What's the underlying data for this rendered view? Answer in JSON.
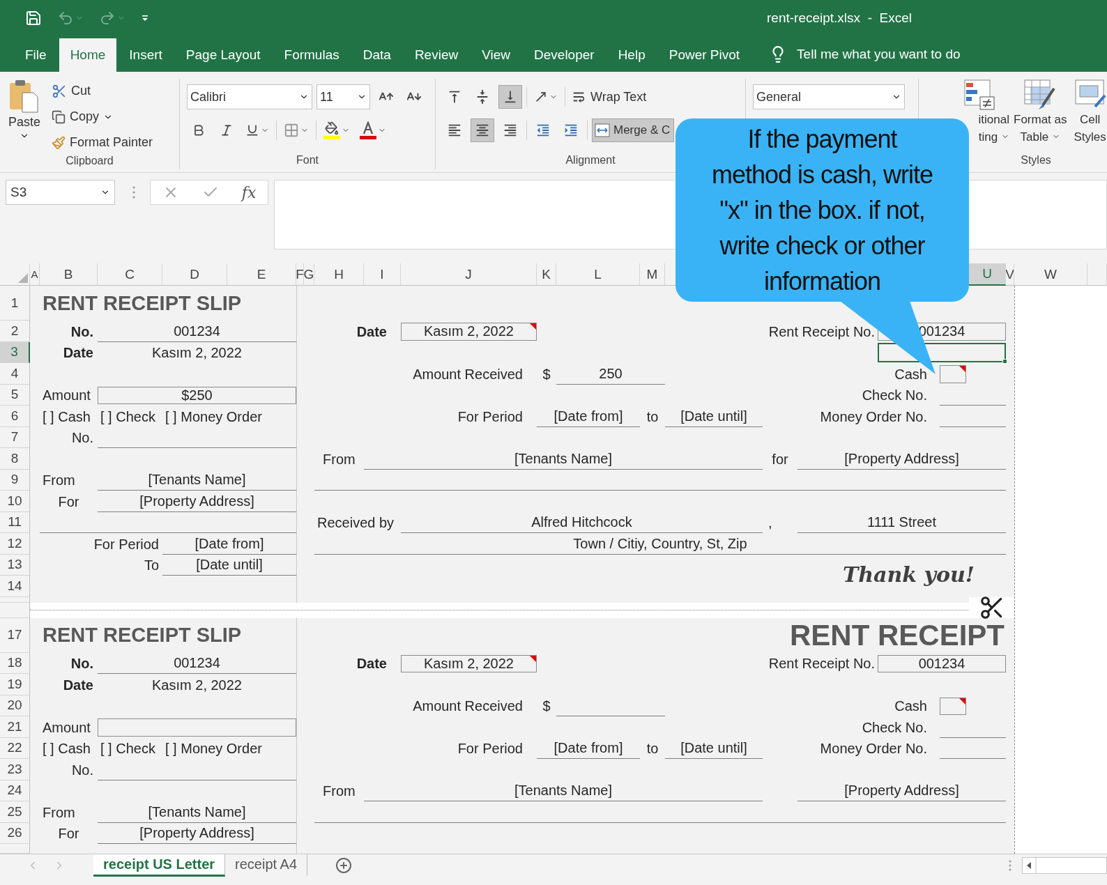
{
  "window": {
    "title": "rent-receipt.xlsx  -  Excel"
  },
  "quick_access": [
    {
      "kind": "save",
      "disabled": false
    },
    {
      "kind": "undo",
      "disabled": true
    },
    {
      "kind": "redo",
      "disabled": true
    },
    {
      "kind": "customize",
      "disabled": false
    }
  ],
  "ribbon_tabs": [
    {
      "label": "File",
      "selected": false
    },
    {
      "label": "Home",
      "selected": true
    },
    {
      "label": "Insert",
      "selected": false
    },
    {
      "label": "Page Layout",
      "selected": false
    },
    {
      "label": "Formulas",
      "selected": false
    },
    {
      "label": "Data",
      "selected": false
    },
    {
      "label": "Review",
      "selected": false
    },
    {
      "label": "View",
      "selected": false
    },
    {
      "label": "Developer",
      "selected": false
    },
    {
      "label": "Help",
      "selected": false
    },
    {
      "label": "Power Pivot",
      "selected": false
    }
  ],
  "tell_me": "Tell me what you want to do",
  "clipboard": {
    "label": "Clipboard",
    "paste": "Paste",
    "cut": "Cut",
    "copy": "Copy",
    "format_painter": "Format Painter"
  },
  "font": {
    "label": "Font",
    "font_name": "Calibri",
    "font_size": "11"
  },
  "alignment": {
    "label": "Alignment",
    "wrap_text": "Wrap Text",
    "merge": {
      "label": "Merge & C",
      "selected": true
    },
    "vertical_align": [
      {
        "kind": "top",
        "selected": false
      },
      {
        "kind": "middle",
        "selected": false
      },
      {
        "kind": "bottom",
        "selected": true
      }
    ],
    "horizontal_align": [
      {
        "kind": "left",
        "selected": false
      },
      {
        "kind": "center",
        "selected": true
      },
      {
        "kind": "right",
        "selected": false
      }
    ]
  },
  "number": {
    "format": "General"
  },
  "styles": {
    "label": "Styles",
    "conditional_formatting": [
      "itional",
      "ting"
    ],
    "format_as_table": [
      "Format as",
      "Table"
    ],
    "cell_styles": [
      "Cell",
      "Styles"
    ]
  },
  "formula_bar": {
    "name_box": "S3",
    "function_label": "fx"
  },
  "sheet": {
    "columns": [
      {
        "label": "A",
        "selected": false
      },
      {
        "label": "B",
        "selected": false
      },
      {
        "label": "C",
        "selected": false
      },
      {
        "label": "D",
        "selected": false
      },
      {
        "label": "E",
        "selected": false
      },
      {
        "label": "F",
        "selected": false
      },
      {
        "label": "G",
        "selected": false
      },
      {
        "label": "H",
        "selected": false
      },
      {
        "label": "I",
        "selected": false
      },
      {
        "label": "J",
        "selected": false
      },
      {
        "label": "K",
        "selected": false
      },
      {
        "label": "L",
        "selected": false
      },
      {
        "label": "M",
        "selected": false
      },
      {
        "label": "U",
        "selected": true
      },
      {
        "label": "V",
        "selected": false
      },
      {
        "label": "W",
        "selected": false
      }
    ],
    "rows": [
      {
        "label": "1",
        "selected": false
      },
      {
        "label": "2",
        "selected": false
      },
      {
        "label": "3",
        "selected": true
      },
      {
        "label": "4",
        "selected": false
      },
      {
        "label": "5",
        "selected": false
      },
      {
        "label": "6",
        "selected": false
      },
      {
        "label": "7",
        "selected": false
      },
      {
        "label": "8",
        "selected": false
      },
      {
        "label": "9",
        "selected": false
      },
      {
        "label": "10",
        "selected": false
      },
      {
        "label": "11",
        "selected": false
      },
      {
        "label": "12",
        "selected": false
      },
      {
        "label": "13",
        "selected": false
      },
      {
        "label": "14",
        "selected": false
      },
      {
        "label": "17",
        "selected": false
      },
      {
        "label": "18",
        "selected": false
      },
      {
        "label": "19",
        "selected": false
      },
      {
        "label": "20",
        "selected": false
      },
      {
        "label": "21",
        "selected": false
      },
      {
        "label": "22",
        "selected": false
      },
      {
        "label": "23",
        "selected": false
      },
      {
        "label": "24",
        "selected": false
      },
      {
        "label": "25",
        "selected": false
      },
      {
        "label": "26",
        "selected": false
      }
    ]
  },
  "copies": [
    {
      "slip": {
        "title": "RENT RECEIPT SLIP",
        "no_label": "No.",
        "no": "001234",
        "date_label": "Date",
        "date": "Kasım 2, 2022",
        "amount_label": "Amount",
        "amount": "$250",
        "payment_options": [
          "[ ] Cash",
          "[ ] Check",
          "[ ] Money Order"
        ],
        "number_label": "No.",
        "from_label": "From",
        "tenant": "[Tenants Name]",
        "for_label": "For",
        "property": "[Property Address]",
        "period_label": "For Period",
        "period_from": "[Date from]",
        "to_label": "To",
        "period_to": "[Date until]"
      },
      "receipt": {
        "date_label": "Date",
        "date": "Kasım 2, 2022",
        "receipt_no_label": "Rent Receipt No.",
        "receipt_no": "001234",
        "amount_label": "Amount Received",
        "currency": "$",
        "amount": "250",
        "cash_label": "Cash",
        "check_label": "Check No.",
        "period_label": "For Period",
        "period_from": "[Date from]",
        "to_label": "to",
        "period_to": "[Date until]",
        "money_order_label": "Money Order No.",
        "from_label": "From",
        "tenant": "[Tenants Name]",
        "for_label": "for",
        "property": "[Property Address]",
        "received_by_label": "Received by",
        "receiver": "Alfred Hitchcock",
        "separator": ",",
        "street": "1111 Street",
        "city": "Town / Citiy, Country, St, Zip",
        "thanks": "Thank you!"
      }
    },
    {
      "slip": {
        "title": "RENT RECEIPT SLIP",
        "no_label": "No.",
        "no": "001234",
        "date_label": "Date",
        "date": "Kasım 2, 2022",
        "amount_label": "Amount",
        "payment_options": [
          "[ ] Cash",
          "[ ] Check",
          "[ ] Money Order"
        ],
        "number_label": "No.",
        "from_label": "From",
        "tenant": "[Tenants Name]",
        "for_label": "For",
        "property": "[Property Address]"
      },
      "receipt": {
        "title": "RENT RECEIPT",
        "date_label": "Date",
        "date": "Kasım 2, 2022",
        "receipt_no_label": "Rent Receipt No.",
        "receipt_no": "001234",
        "amount_label": "Amount Received",
        "currency": "$",
        "cash_label": "Cash",
        "check_label": "Check No.",
        "period_label": "For Period",
        "period_from": "[Date from]",
        "to_label": "to",
        "period_to": "[Date until]",
        "money_order_label": "Money Order No.",
        "from_label": "From",
        "tenant": "[Tenants Name]",
        "property": "[Property Address]"
      }
    }
  ],
  "sheet_tabs": [
    {
      "label": "receipt US Letter",
      "selected": true
    },
    {
      "label": "receipt A4",
      "selected": false
    }
  ],
  "callout": {
    "lines": [
      "If the payment",
      "method is cash, write",
      "\"x\" in the box. if not,",
      "write check or other",
      "information"
    ]
  }
}
